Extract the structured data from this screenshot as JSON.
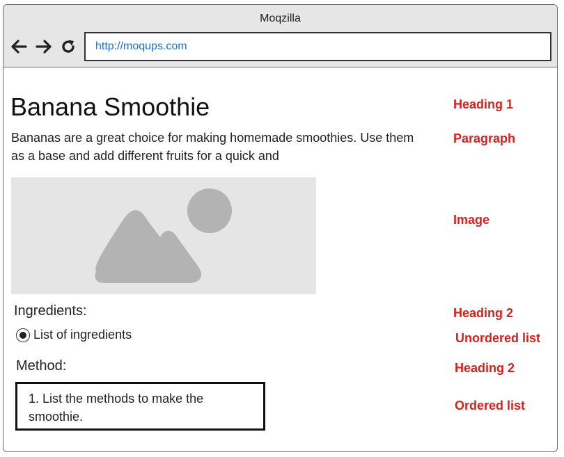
{
  "window": {
    "title": "Moqzilla"
  },
  "toolbar": {
    "url": "http://moqups.com",
    "back_icon": "back-arrow-icon",
    "forward_icon": "forward-arrow-icon",
    "reload_icon": "reload-icon"
  },
  "page": {
    "heading1": "Banana Smoothie",
    "paragraph": "Bananas are a great choice for making homemade smoothies. Use them as a base and add different fruits for a quick and",
    "image_icon": "image-placeholder-icon",
    "ingredients_heading": "Ingredients:",
    "ingredients_items": [
      "List of ingredients"
    ],
    "method_heading": "Method:",
    "method_items": [
      "1. List the methods to make the smoothie."
    ]
  },
  "annotations": {
    "heading1": "Heading 1",
    "paragraph": "Paragraph",
    "image": "Image",
    "heading2_a": "Heading 2",
    "unordered_list": "Unordered list",
    "heading2_b": "Heading 2",
    "ordered_list": "Ordered list"
  },
  "colors": {
    "annotation": "#d8211d",
    "url_text": "#1a73c8",
    "chrome_bg": "#e6e6e6",
    "image_bg": "#e5e5e5",
    "image_shape": "#b3b3b3"
  }
}
